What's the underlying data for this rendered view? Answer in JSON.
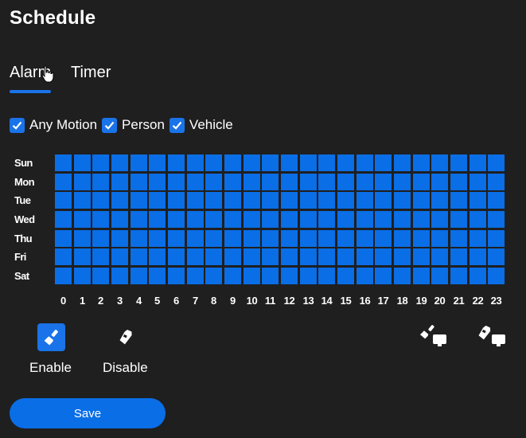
{
  "header": {
    "title": "Schedule"
  },
  "tabs": [
    {
      "label": "Alarm",
      "active": true
    },
    {
      "label": "Timer",
      "active": false
    }
  ],
  "filters": [
    {
      "label": "Any Motion",
      "checked": true
    },
    {
      "label": "Person",
      "checked": true
    },
    {
      "label": "Vehicle",
      "checked": true
    }
  ],
  "schedule": {
    "days": [
      "Sun",
      "Mon",
      "Tue",
      "Wed",
      "Thu",
      "Fri",
      "Sat"
    ],
    "hours": [
      "0",
      "1",
      "2",
      "3",
      "4",
      "5",
      "6",
      "7",
      "8",
      "9",
      "10",
      "11",
      "12",
      "13",
      "14",
      "15",
      "16",
      "17",
      "18",
      "19",
      "20",
      "21",
      "22",
      "23"
    ],
    "all_slots_enabled": true
  },
  "tools": {
    "enable_label": "Enable",
    "disable_label": "Disable",
    "active_tool": "enable"
  },
  "actions": {
    "save_label": "Save"
  },
  "colors": {
    "background": "#1f1f1f",
    "accent": "#1a73e8",
    "slot_enabled": "#0a6ee6",
    "text": "#ffffff"
  }
}
